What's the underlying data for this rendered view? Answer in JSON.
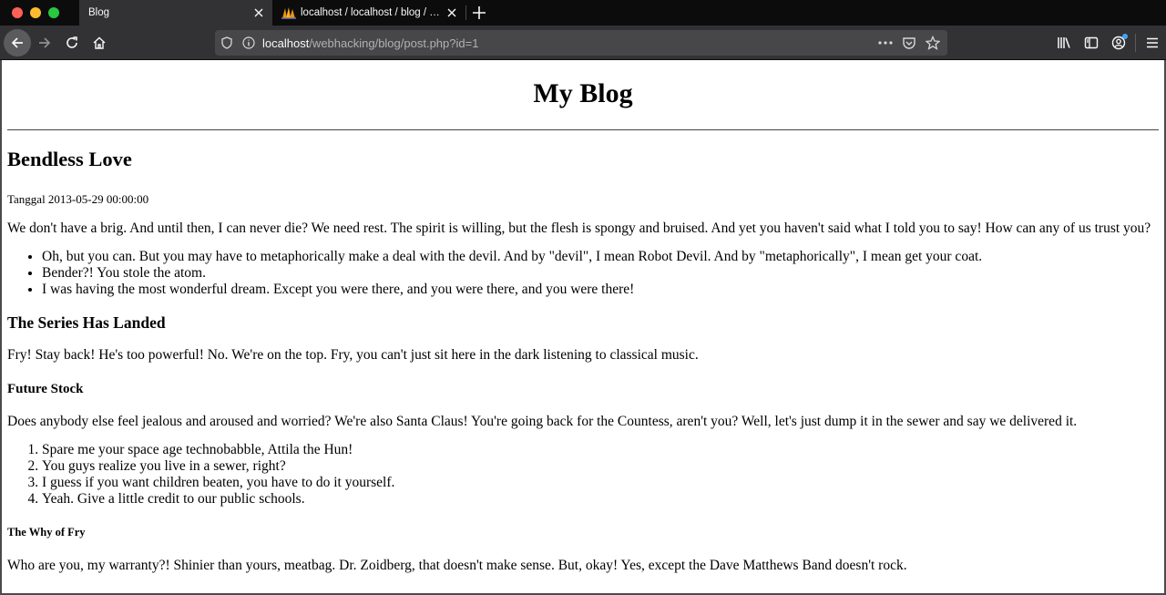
{
  "browser": {
    "tabs": [
      {
        "title": "Blog",
        "active": true
      },
      {
        "title": "localhost / localhost / blog / users | phpMyAdmin",
        "active": false
      }
    ],
    "url": {
      "host": "localhost",
      "path": "/webhacking/blog/post.php?id=1"
    }
  },
  "page": {
    "site_title": "My Blog",
    "post_title": "Bendless Love",
    "date_line": "Tanggal 2013-05-29 00:00:00",
    "intro": "We don't have a brig. And until then, I can never die? We need rest. The spirit is willing, but the flesh is spongy and bruised. And yet you haven't said what I told you to say! How can any of us trust you?",
    "bullets": [
      "Oh, but you can. But you may have to metaphorically make a deal with the devil. And by \"devil\", I mean Robot Devil. And by \"metaphorically\", I mean get your coat.",
      "Bender?! You stole the atom.",
      "I was having the most wonderful dream. Except you were there, and you were there, and you were there!"
    ],
    "section1_heading": "The Series Has Landed",
    "section1_text": "Fry! Stay back! He's too powerful! No. We're on the top. Fry, you can't just sit here in the dark listening to classical music.",
    "section2_heading": "Future Stock",
    "section2_text": "Does anybody else feel jealous and aroused and worried? We're also Santa Claus! You're going back for the Countess, aren't you? Well, let's just dump it in the sewer and say we delivered it.",
    "numbered": [
      "Spare me your space age technobabble, Attila the Hun!",
      "You guys realize you live in a sewer, right?",
      "I guess if you want children beaten, you have to do it yourself.",
      "Yeah. Give a little credit to our public schools."
    ],
    "section3_heading": "The Why of Fry",
    "section3_text": "Who are you, my warranty?! Shinier than yours, meatbag. Dr. Zoidberg, that doesn't make sense. But, okay! Yes, except the Dave Matthews Band doesn't rock."
  },
  "colors": {
    "chrome_dark": "#0c0c0d",
    "toolbar": "#323234",
    "urlbar": "#474749",
    "notification_dot": "#45a1ff"
  }
}
